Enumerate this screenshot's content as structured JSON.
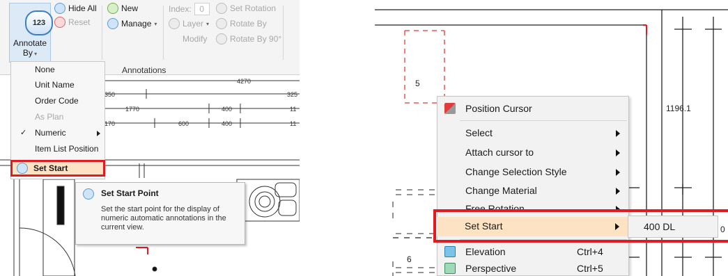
{
  "ribbon": {
    "annotate_icon_text": "123",
    "annotate_label": "Annotate",
    "annotate_by_label": "By",
    "hide_all": "Hide All",
    "reset": "Reset",
    "new": "New",
    "manage": "Manage",
    "index_label": "Index:",
    "index_value": "0",
    "layer": "Layer",
    "modify": "Modify",
    "set_rotation": "Set Rotation",
    "rotate_by": "Rotate By",
    "rotate_by_90": "Rotate By 90°",
    "group_label": "Annotations"
  },
  "annotate_menu": {
    "items": [
      {
        "label": "None",
        "enabled": true,
        "checked": false
      },
      {
        "label": "Unit Name",
        "enabled": true,
        "checked": false
      },
      {
        "label": "Order Code",
        "enabled": true,
        "checked": false
      },
      {
        "label": "As Plan",
        "enabled": false,
        "checked": false
      },
      {
        "label": "Numeric",
        "enabled": true,
        "checked": true
      },
      {
        "label": "Item List Position",
        "enabled": true,
        "checked": false
      }
    ],
    "set_start": "Set Start",
    "check_glyph": "✓"
  },
  "tooltip": {
    "title": "Set Start Point",
    "body": "Set the start point for the display of numeric automatic annotations in the current view."
  },
  "left_drawing": {
    "dim_top": "4270",
    "row1": [
      "350",
      "325"
    ],
    "row2": [
      "1770",
      "400",
      "11"
    ],
    "row3": [
      "170",
      "600",
      "400",
      "11"
    ]
  },
  "right_drawing": {
    "label_5": "5",
    "label_6": "6",
    "dimension": "1196.1",
    "edge_digit": "0"
  },
  "context_menu": {
    "items": [
      {
        "label": "Position Cursor",
        "shortcut": "",
        "submenu": false,
        "icon": "cursor-icon"
      },
      {
        "label": "Select",
        "shortcut": "",
        "submenu": true,
        "icon": ""
      },
      {
        "label": "Attach cursor to",
        "shortcut": "",
        "submenu": true,
        "icon": ""
      },
      {
        "label": "Change Selection Style",
        "shortcut": "",
        "submenu": true,
        "icon": ""
      },
      {
        "label": "Change Material",
        "shortcut": "",
        "submenu": true,
        "icon": ""
      },
      {
        "label": "Free Rotation",
        "shortcut": "",
        "submenu": true,
        "icon": ""
      },
      {
        "label": "Set Start",
        "shortcut": "",
        "submenu": true,
        "icon": ""
      },
      {
        "label": "Elevation",
        "shortcut": "Ctrl+4",
        "submenu": false,
        "icon": "elevation-icon"
      },
      {
        "label": "Perspective",
        "shortcut": "Ctrl+5",
        "submenu": false,
        "icon": "perspective-icon"
      }
    ],
    "submenu_value": "400 DL"
  },
  "colors": {
    "highlight_border": "#e11b22",
    "highlight_fill": "#fde3c4",
    "accent_blue": "#3d7fc4"
  }
}
